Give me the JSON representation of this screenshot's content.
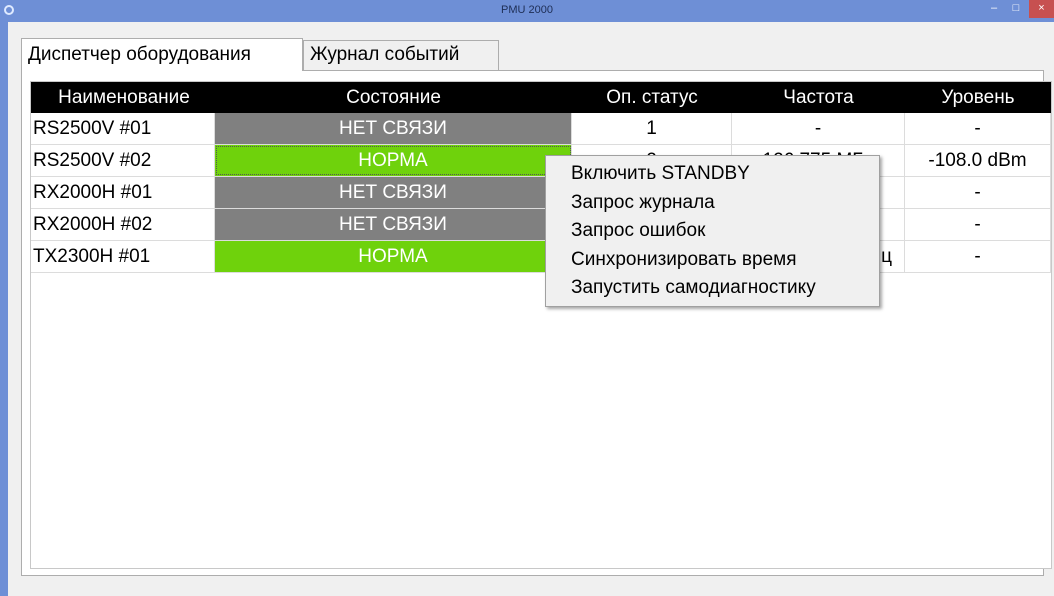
{
  "window": {
    "title": "PMU 2000",
    "minimize_glyph": "–",
    "maximize_glyph": "□",
    "close_glyph": "×"
  },
  "tabs": [
    {
      "label": "Диспетчер оборудования",
      "active": true
    },
    {
      "label": "Журнал событий",
      "active": false
    }
  ],
  "table": {
    "columns": [
      "Наименование",
      "Состояние",
      "Оп. статус",
      "Частота",
      "Уровень"
    ],
    "rows": [
      {
        "name": "RS2500V #01",
        "state": "НЕТ СВЯЗИ",
        "state_color": "#808080",
        "op_status": "1",
        "frequency": "-",
        "level": "-"
      },
      {
        "name": "RS2500V #02",
        "state": "НОРМА",
        "state_color": "#6fd20c",
        "op_status": "2",
        "frequency": "126.775 МГц",
        "level": "-108.0 dBm"
      },
      {
        "name": "RX2000H #01",
        "state": "НЕТ СВЯЗИ",
        "state_color": "#808080",
        "op_status": "",
        "frequency": "",
        "level": "-"
      },
      {
        "name": "RX2000H #02",
        "state": "НЕТ СВЯЗИ",
        "state_color": "#808080",
        "op_status": "",
        "frequency": "",
        "level": "-"
      },
      {
        "name": "TX2300H #01",
        "state": "НОРМА",
        "state_color": "#6fd20c",
        "op_status": "",
        "frequency": "ц",
        "level": "-"
      }
    ]
  },
  "context_menu": {
    "items": [
      "Включить STANDBY",
      "Запрос журнала",
      "Запрос ошибок",
      "Синхронизировать время",
      "Запустить самодиагностику"
    ]
  },
  "colors": {
    "titlebar": "#6e8fd6",
    "header_bg": "#000000",
    "state_normal": "#6fd20c",
    "state_no_link": "#808080",
    "close_button": "#c75050"
  }
}
